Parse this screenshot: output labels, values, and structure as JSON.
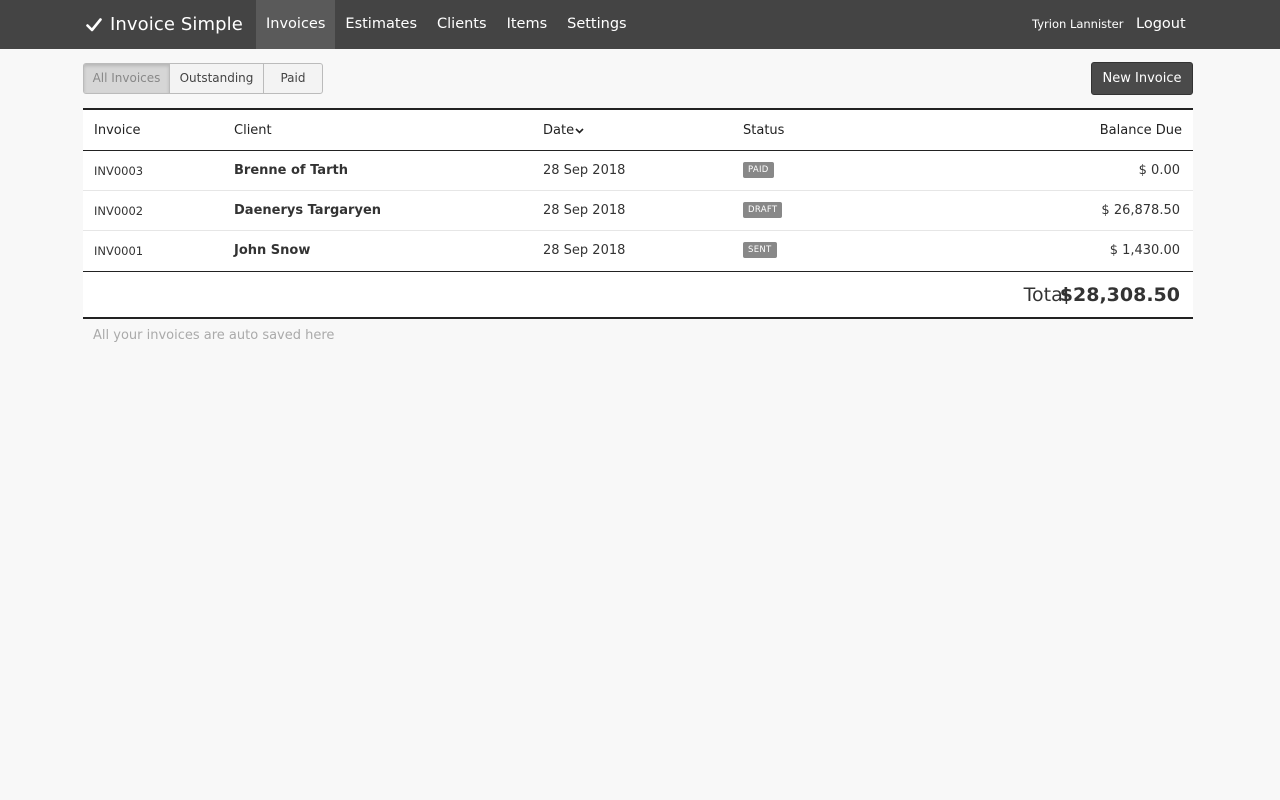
{
  "brand": {
    "name": "Invoice Simple"
  },
  "nav": {
    "items": [
      {
        "label": "Invoices",
        "active": true
      },
      {
        "label": "Estimates",
        "active": false
      },
      {
        "label": "Clients",
        "active": false
      },
      {
        "label": "Items",
        "active": false
      },
      {
        "label": "Settings",
        "active": false
      }
    ],
    "user_name": "Tyrion Lannister",
    "logout_label": "Logout"
  },
  "filters": {
    "buttons": [
      {
        "label": "All Invoices",
        "active": true
      },
      {
        "label": "Outstanding",
        "active": false
      },
      {
        "label": "Paid",
        "active": false
      }
    ]
  },
  "toolbar": {
    "new_invoice_label": "New Invoice"
  },
  "table": {
    "columns": {
      "invoice": "Invoice",
      "client": "Client",
      "date": "Date",
      "status": "Status",
      "balance": "Balance Due"
    },
    "rows": [
      {
        "invoice": "INV0003",
        "client": "Brenne of Tarth",
        "date": "28 Sep 2018",
        "status": "PAID",
        "balance": "$ 0.00"
      },
      {
        "invoice": "INV0002",
        "client": "Daenerys Targaryen",
        "date": "28 Sep 2018",
        "status": "DRAFT",
        "balance": "$ 26,878.50"
      },
      {
        "invoice": "INV0001",
        "client": "John Snow",
        "date": "28 Sep 2018",
        "status": "SENT",
        "balance": "$ 1,430.00"
      }
    ],
    "total_label": "Total",
    "total_value": "$28,308.50"
  },
  "footnote": "All your invoices are auto saved here",
  "colors": {
    "topbar": "#444444",
    "nav_active": "#5a5a5a",
    "badge": "#888888",
    "page_bg": "#f8f8f8"
  },
  "icons": {
    "brand": "checkmark-icon",
    "sort": "chevron-down-icon"
  }
}
